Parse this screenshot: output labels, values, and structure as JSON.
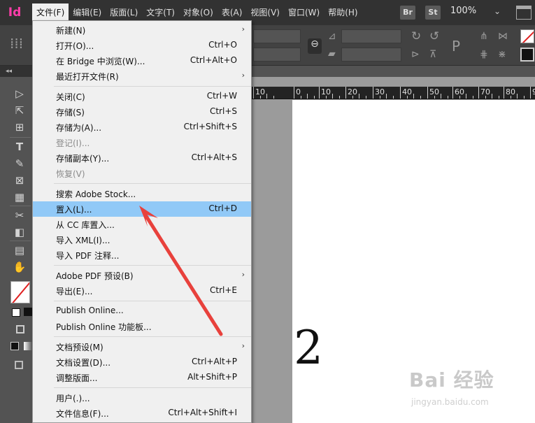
{
  "app": {
    "logo": "Id"
  },
  "menubar": {
    "items": [
      "文件(F)",
      "编辑(E)",
      "版面(L)",
      "文字(T)",
      "对象(O)",
      "表(A)",
      "视图(V)",
      "窗口(W)",
      "帮助(H)"
    ],
    "active_index": 0,
    "bridge_badge": "Br",
    "stock_badge": "St",
    "zoom": "100%",
    "zoom_caret": "⌄"
  },
  "file_menu": {
    "items": [
      {
        "label": "新建(N)",
        "shortcut": "",
        "submenu": true,
        "disabled": false
      },
      {
        "label": "打开(O)...",
        "shortcut": "Ctrl+O",
        "submenu": false,
        "disabled": false
      },
      {
        "label": "在 Bridge 中浏览(W)...",
        "shortcut": "Ctrl+Alt+O",
        "submenu": false,
        "disabled": false
      },
      {
        "label": "最近打开文件(R)",
        "shortcut": "",
        "submenu": true,
        "disabled": false
      },
      {
        "label": "关闭(C)",
        "shortcut": "Ctrl+W",
        "submenu": false,
        "disabled": false
      },
      {
        "label": "存储(S)",
        "shortcut": "Ctrl+S",
        "submenu": false,
        "disabled": false
      },
      {
        "label": "存储为(A)...",
        "shortcut": "Ctrl+Shift+S",
        "submenu": false,
        "disabled": false
      },
      {
        "label": "登记(I)...",
        "shortcut": "",
        "submenu": false,
        "disabled": true
      },
      {
        "label": "存储副本(Y)...",
        "shortcut": "Ctrl+Alt+S",
        "submenu": false,
        "disabled": false
      },
      {
        "label": "恢复(V)",
        "shortcut": "",
        "submenu": false,
        "disabled": true
      },
      {
        "label": "搜索 Adobe Stock...",
        "shortcut": "",
        "submenu": false,
        "disabled": false
      },
      {
        "label": "置入(L)...",
        "shortcut": "Ctrl+D",
        "submenu": false,
        "disabled": false,
        "highlighted": true
      },
      {
        "label": "从 CC 库置入...",
        "shortcut": "",
        "submenu": false,
        "disabled": false
      },
      {
        "label": "导入 XML(I)...",
        "shortcut": "",
        "submenu": false,
        "disabled": false
      },
      {
        "label": "导入 PDF 注释...",
        "shortcut": "",
        "submenu": false,
        "disabled": false
      },
      {
        "label": "Adobe PDF 预设(B)",
        "shortcut": "",
        "submenu": true,
        "disabled": false
      },
      {
        "label": "导出(E)...",
        "shortcut": "Ctrl+E",
        "submenu": false,
        "disabled": false
      },
      {
        "label": "Publish Online...",
        "shortcut": "",
        "submenu": false,
        "disabled": false
      },
      {
        "label": "Publish Online 功能板...",
        "shortcut": "",
        "submenu": false,
        "disabled": false
      },
      {
        "label": "文档预设(M)",
        "shortcut": "",
        "submenu": true,
        "disabled": false
      },
      {
        "label": "文档设置(D)...",
        "shortcut": "Ctrl+Alt+P",
        "submenu": false,
        "disabled": false
      },
      {
        "label": "调整版面...",
        "shortcut": "Alt+Shift+P",
        "submenu": false,
        "disabled": false
      },
      {
        "label": "用户(.)...",
        "shortcut": "",
        "submenu": false,
        "disabled": false
      },
      {
        "label": "文件信息(F)...",
        "shortcut": "Ctrl+Alt+Shift+I",
        "submenu": false,
        "disabled": false
      }
    ]
  },
  "ruler": {
    "labels": [
      "10",
      "0",
      "10",
      "20",
      "30",
      "40",
      "50",
      "60",
      "70",
      "80",
      "9"
    ]
  },
  "document": {
    "visible_text": "2"
  },
  "watermark": {
    "text": "Bai 经验",
    "subtext": "jingyan.baidu.com"
  },
  "colors": {
    "highlight": "#91c9f7",
    "arrow": "#e8413c",
    "logo": "#ff3daa"
  }
}
